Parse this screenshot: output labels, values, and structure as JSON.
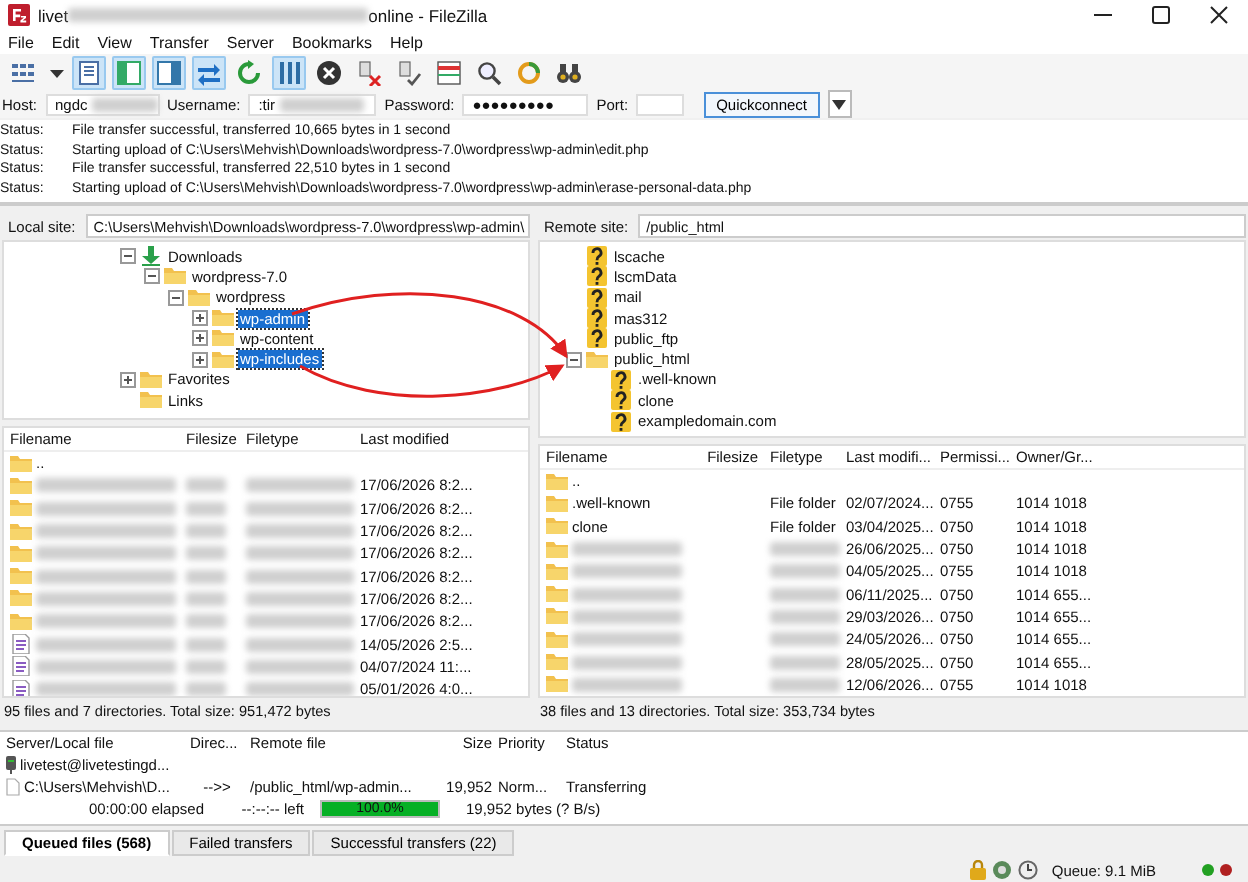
{
  "window": {
    "title_start": "livet",
    "title_end": "online - FileZilla"
  },
  "menu": [
    "File",
    "Edit",
    "View",
    "Transfer",
    "Server",
    "Bookmarks",
    "Help"
  ],
  "toolbar": [
    {
      "kind": "grid",
      "on": false
    },
    {
      "kind": "caret",
      "on": false
    },
    {
      "kind": "log",
      "on": true
    },
    {
      "kind": "local",
      "on": true
    },
    {
      "kind": "remote",
      "on": true
    },
    {
      "kind": "swap",
      "on": true
    },
    {
      "kind": "refresh",
      "on": false
    },
    {
      "kind": "queue",
      "on": true
    },
    {
      "kind": "cancel",
      "on": false
    },
    {
      "kind": "disconnect",
      "on": false
    },
    {
      "kind": "reconnect",
      "on": false
    },
    {
      "kind": "filter",
      "on": false
    },
    {
      "kind": "compare",
      "on": false
    },
    {
      "kind": "sync",
      "on": false
    },
    {
      "kind": "find",
      "on": false
    }
  ],
  "quickconnect": {
    "host_label": "Host:",
    "host_value": "ngdc",
    "username_label": "Username:",
    "username_value": ":tir",
    "password_label": "Password:",
    "password_value": "●●●●●●●●●",
    "port_label": "Port:",
    "button": "Quickconnect"
  },
  "log": [
    {
      "label": "Status:",
      "message": "File transfer successful, transferred 10,665 bytes in 1 second"
    },
    {
      "label": "Status:",
      "message": "Starting upload of C:\\Users\\Mehvish\\Downloads\\wordpress-7.0\\wordpress\\wp-admin\\edit.php"
    },
    {
      "label": "Status:",
      "message": "File transfer successful, transferred 22,510 bytes in 1 second"
    },
    {
      "label": "Status:",
      "message": "Starting upload of C:\\Users\\Mehvish\\Downloads\\wordpress-7.0\\wordpress\\wp-admin\\erase-personal-data.php"
    }
  ],
  "local": {
    "site_label": "Local site:",
    "path": "C:\\Users\\Mehvish\\Downloads\\wordpress-7.0\\wordpress\\wp-admin\\",
    "tree": [
      {
        "label": "Downloads",
        "kind": "download",
        "expanded": true,
        "children": [
          {
            "label": "wordpress-7.0",
            "kind": "folder",
            "expanded": true,
            "children": [
              {
                "label": "wordpress",
                "kind": "folder",
                "expanded": true,
                "children": [
                  {
                    "label": "wp-admin",
                    "kind": "folder",
                    "expanded": false,
                    "selected": true
                  },
                  {
                    "label": "wp-content",
                    "kind": "folder",
                    "expanded": false,
                    "selected": false
                  },
                  {
                    "label": "wp-includes",
                    "kind": "folder",
                    "expanded": false,
                    "selected": true
                  }
                ]
              }
            ]
          }
        ]
      },
      {
        "label": "Favorites",
        "kind": "folder",
        "expanded": false
      },
      {
        "label": "Links",
        "kind": "folder"
      }
    ],
    "columns": [
      "Filename",
      "Filesize",
      "Filetype",
      "Last modified"
    ],
    "rows": [
      {
        "kind": "folder",
        "filename": ".."
      },
      {
        "kind": "folder",
        "modified": "17/06/2026 8:2..."
      },
      {
        "kind": "folder",
        "modified": "17/06/2026 8:2..."
      },
      {
        "kind": "folder",
        "modified": "17/06/2026 8:2..."
      },
      {
        "kind": "folder",
        "modified": "17/06/2026 8:2..."
      },
      {
        "kind": "folder",
        "modified": "17/06/2026 8:2..."
      },
      {
        "kind": "folder",
        "modified": "17/06/2026 8:2..."
      },
      {
        "kind": "folder",
        "modified": "17/06/2026 8:2..."
      },
      {
        "kind": "file",
        "modified": "14/05/2026 2:5..."
      },
      {
        "kind": "file",
        "modified": "04/07/2024 11:..."
      },
      {
        "kind": "file",
        "modified": "05/01/2026 4:0..."
      }
    ],
    "summary": "95 files and 7 directories. Total size: 951,472 bytes"
  },
  "remote": {
    "site_label": "Remote site:",
    "path": "/public_html",
    "tree": [
      {
        "label": "lscache",
        "kind": "question"
      },
      {
        "label": "lscmData",
        "kind": "question"
      },
      {
        "label": "mail",
        "kind": "question"
      },
      {
        "label": "mas312",
        "kind": "question"
      },
      {
        "label": "public_ftp",
        "kind": "question"
      },
      {
        "label": "public_html",
        "kind": "folder",
        "expanded": true,
        "children": [
          {
            "label": ".well-known",
            "kind": "question"
          },
          {
            "label": "clone",
            "kind": "question"
          },
          {
            "label": "exampledomain.com",
            "kind": "question"
          }
        ]
      }
    ],
    "columns": [
      "Filename",
      "Filesize",
      "Filetype",
      "Last modifi...",
      "Permissi...",
      "Owner/Gr..."
    ],
    "rows": [
      {
        "kind": "folder",
        "filename": ".."
      },
      {
        "kind": "folder",
        "filename": ".well-known",
        "filetype": "File folder",
        "modified": "02/07/2024...",
        "permissions": "0755",
        "owner": "1014 1018"
      },
      {
        "kind": "folder",
        "filename": "clone",
        "filetype": "File folder",
        "modified": "03/04/2025...",
        "permissions": "0750",
        "owner": "1014 1018"
      },
      {
        "kind": "folder",
        "modified": "26/06/2025...",
        "permissions": "0750",
        "owner": "1014 1018"
      },
      {
        "kind": "folder",
        "modified": "04/05/2025...",
        "permissions": "0755",
        "owner": "1014 1018"
      },
      {
        "kind": "folder",
        "modified": "06/11/2025...",
        "permissions": "0750",
        "owner": "1014 655..."
      },
      {
        "kind": "folder",
        "modified": "29/03/2026...",
        "permissions": "0750",
        "owner": "1014 655..."
      },
      {
        "kind": "folder",
        "modified": "24/05/2026...",
        "permissions": "0750",
        "owner": "1014 655..."
      },
      {
        "kind": "folder",
        "modified": "28/05/2025...",
        "permissions": "0750",
        "owner": "1014 655..."
      },
      {
        "kind": "folder",
        "modified": "12/06/2026...",
        "permissions": "0755",
        "owner": "1014 1018"
      }
    ],
    "summary": "38 files and 13 directories. Total size: 353,734 bytes"
  },
  "queue": {
    "columns": [
      "Server/Local file",
      "Direc...",
      "Remote file",
      "Size",
      "Priority",
      "Status"
    ],
    "rows": [
      {
        "kind": "server",
        "text": "livetest@livetestingd..."
      },
      {
        "kind": "file",
        "local": "C:\\Users\\Mehvish\\D...",
        "direction": "-->>",
        "remote": "/public_html/wp-admin...",
        "size": "19,952",
        "priority": "Norm...",
        "status": "Transferring"
      },
      {
        "kind": "progress",
        "elapsed": "00:00:00 elapsed",
        "left": "--:--:-- left",
        "level": 1.0,
        "percent": "100.0%",
        "bytes": "19,952 bytes (? B/s)"
      }
    ]
  },
  "tabs": [
    {
      "label": "Queued files (568)",
      "selected": true
    },
    {
      "label": "Failed transfers",
      "selected": false
    },
    {
      "label": "Successful transfers (22)",
      "selected": false
    }
  ],
  "status_bar": {
    "queue": "Queue: 9.1 MiB",
    "lights": [
      {
        "color": "#22a022"
      },
      {
        "color": "#b02020"
      }
    ]
  }
}
